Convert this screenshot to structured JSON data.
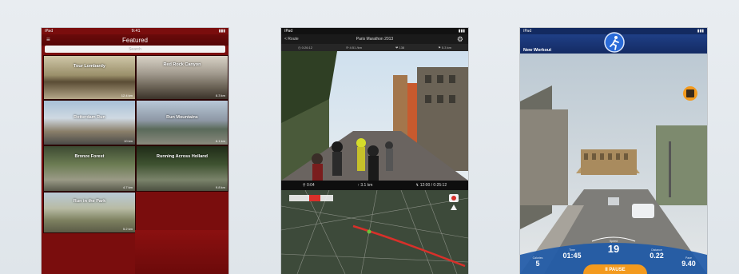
{
  "panel_featured": {
    "time": "9:41",
    "title": "Featured",
    "search_placeholder": "Search",
    "tiles": [
      {
        "name": "Tour Lombardy",
        "sub": "",
        "dist": "12.4 km"
      },
      {
        "name": "Red Rock Canyon",
        "sub": "",
        "dist": "8.3 km"
      },
      {
        "name": "Rotterdam Run",
        "sub": "",
        "dist": "10 km"
      },
      {
        "name": "Run Mountains",
        "sub": "",
        "dist": "6.1 km"
      },
      {
        "name": "Bronze Forest",
        "sub": "",
        "dist": "4.7 km"
      },
      {
        "name": "Running Across Holland",
        "sub": "",
        "dist": "9.8 km"
      },
      {
        "name": "Run in the Park",
        "sub": "",
        "dist": "5.2 km"
      }
    ]
  },
  "panel_paris": {
    "back_label": "< Route",
    "title": "Paris Marathon 2013",
    "toolbar": [
      "◷ 0:26:12",
      "⟳ 4:51 /km",
      "❤ 138",
      "⚑ 5.3 km"
    ],
    "stats": [
      "⚲ 0:04",
      "↑ 3.1 km",
      "↯ 12:00 / 0:25:12"
    ]
  },
  "panel_workout": {
    "nav_title": "New Workout",
    "stats": [
      {
        "label": "Calories",
        "value": "5"
      },
      {
        "label": "Time",
        "value": "01:45"
      },
      {
        "label": "Speed",
        "value": "19"
      },
      {
        "label": "Distance",
        "value": "0.22"
      },
      {
        "label": "Pace",
        "value": "9.40"
      }
    ],
    "pause_label": "II PAUSE"
  }
}
